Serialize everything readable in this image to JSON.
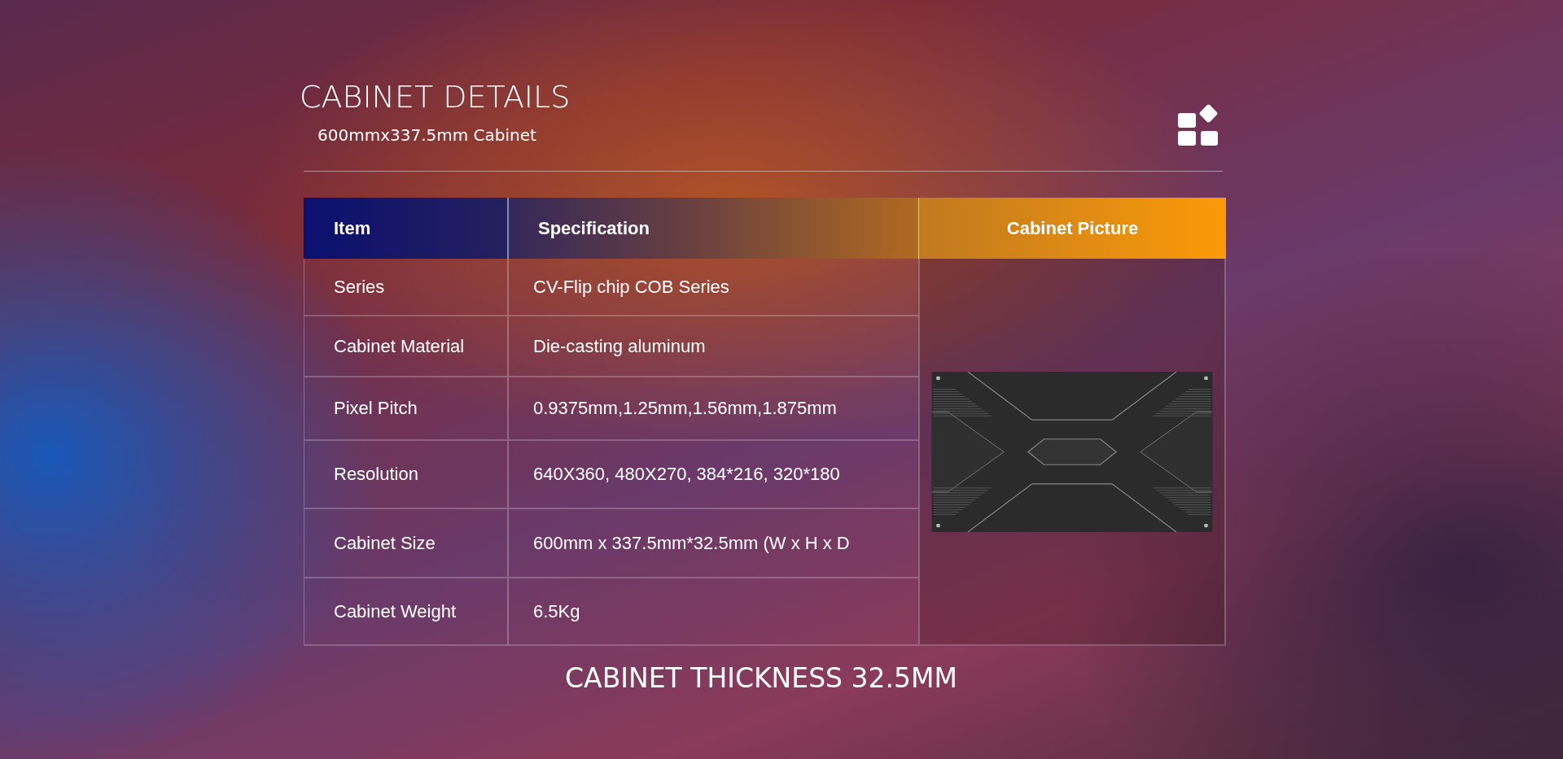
{
  "header": {
    "title": "CABINET DETAILS",
    "subtitle": "600mmx337.5mm Cabinet"
  },
  "table": {
    "columns": [
      "Item",
      "Specification",
      "Cabinet Picture"
    ],
    "rows": [
      {
        "item": "Series",
        "specification": "CV-Flip chip COB Series"
      },
      {
        "item": "Cabinet Material",
        "specification": "Die-casting aluminum"
      },
      {
        "item": "Pixel Pitch",
        "specification": "0.9375mm,1.25mm,1.56mm,1.875mm"
      },
      {
        "item": "Resolution",
        "specification": "640X360, 480X270, 384*216, 320*180"
      },
      {
        "item": "Cabinet Size",
        "specification": "600mm x 337.5mm*32.5mm (W x H x D"
      },
      {
        "item": "Cabinet Weight",
        "specification": "6.5Kg"
      }
    ]
  },
  "footer": {
    "caption": "CABINET THICKNESS 32.5MM"
  }
}
